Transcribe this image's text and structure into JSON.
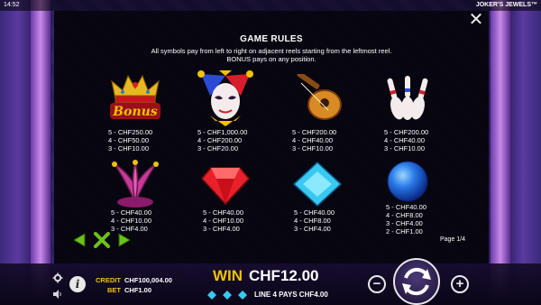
{
  "status_bar": {
    "time": "14:52",
    "game_title": "JOKER'S JEWELS™"
  },
  "rules": {
    "title": "GAME RULES",
    "line1": "All symbols pay from left to right on adjacent reels starting from the leftmost reel.",
    "line2": "BONUS pays on any position.",
    "close_label": "✕",
    "page_indicator": "Page 1/4"
  },
  "symbols": [
    {
      "icon": "bonus-crown-icon",
      "pays": [
        "5 - CHF250.00",
        "4 - CHF50.00",
        "3 - CHF10.00"
      ]
    },
    {
      "icon": "joker-icon",
      "pays": [
        "5 - CHF1,000.00",
        "4 - CHF200.00",
        "3 - CHF20.00"
      ]
    },
    {
      "icon": "lute-icon",
      "pays": [
        "5 - CHF200.00",
        "4 - CHF40.00",
        "3 - CHF10.00"
      ]
    },
    {
      "icon": "juggling-pins-icon",
      "pays": [
        "5 - CHF200.00",
        "4 - CHF40.00",
        "3 - CHF10.00"
      ]
    },
    {
      "icon": "jester-hat-icon",
      "pays": [
        "5 - CHF40.00",
        "4 - CHF10.00",
        "3 - CHF4.00"
      ]
    },
    {
      "icon": "red-diamond-icon",
      "pays": [
        "5 - CHF40.00",
        "4 - CHF10.00",
        "3 - CHF4.00"
      ]
    },
    {
      "icon": "blue-diamond-icon",
      "pays": [
        "5 - CHF40.00",
        "4 - CHF8.00",
        "3 - CHF4.00"
      ]
    },
    {
      "icon": "blue-sphere-icon",
      "pays": [
        "5 - CHF40.00",
        "4 - CHF8.00",
        "3 - CHF4.00",
        "2 - CHF1.00"
      ]
    }
  ],
  "bonus_word": "Bonus",
  "bottom_bar": {
    "credit_label": "CREDIT",
    "credit_value": "CHF100,004.00",
    "bet_label": "BET",
    "bet_value": "CHF1.00",
    "win_label": "WIN",
    "win_value": "CHF12.00",
    "line_pays": "LINE 4 PAYS CHF4.00",
    "info_label": "i",
    "minus_label": "−",
    "plus_label": "+"
  },
  "colors": {
    "gold": "#f2c200",
    "panel_bg": "#04040a",
    "nav_green": "#6cc21a"
  }
}
